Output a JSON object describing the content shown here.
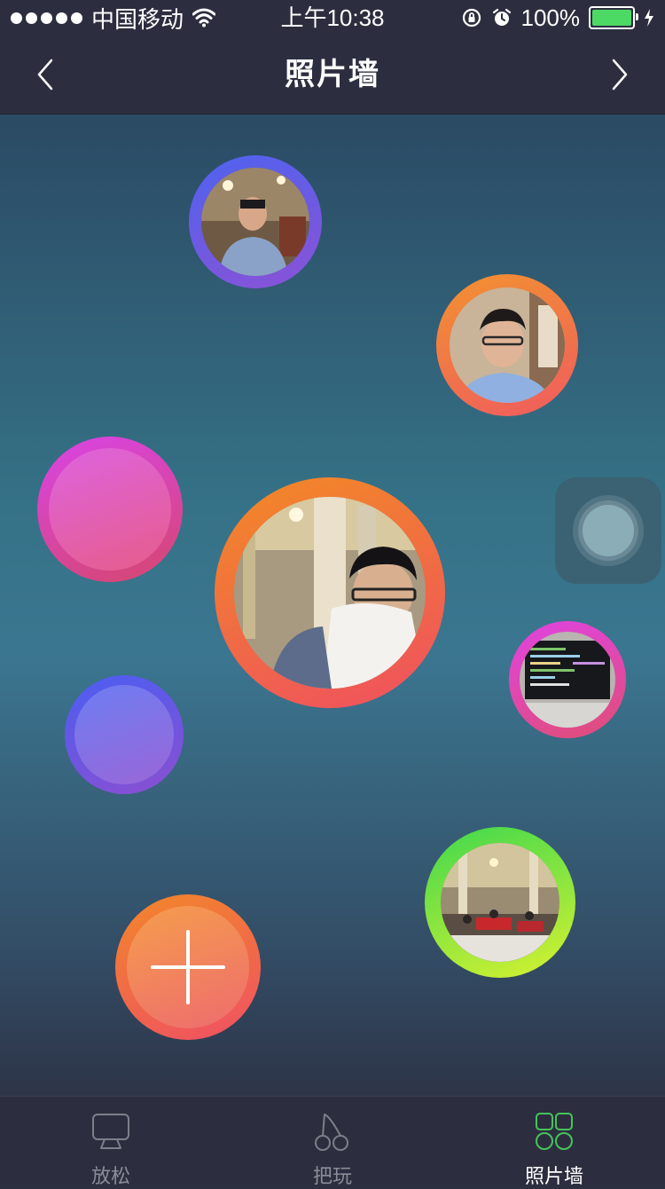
{
  "status_bar": {
    "carrier": "中国移动",
    "time": "上午10:38",
    "battery": "100%"
  },
  "nav": {
    "title": "照片墙",
    "back_icon": "chevron-left-icon",
    "forward_icon": "chevron-right-icon"
  },
  "bubbles": [
    {
      "kind": "photo",
      "subject": "portrait",
      "ring": [
        "#4e63ef",
        "#8b52d6"
      ]
    },
    {
      "kind": "photo",
      "subject": "portrait",
      "ring": [
        "#f29230",
        "#ef5c5f"
      ]
    },
    {
      "kind": "empty",
      "ring": [
        "#d844e6",
        "#d6476e"
      ],
      "fill": [
        "#de63e0",
        "#e65d8a"
      ]
    },
    {
      "kind": "photo",
      "subject": "selfie",
      "ring": [
        "#f28a25",
        "#ef5060"
      ]
    },
    {
      "kind": "photo",
      "subject": "screen",
      "ring": [
        "#e043e3",
        "#e04e74"
      ]
    },
    {
      "kind": "empty",
      "ring": [
        "#4b5ef2",
        "#8b4fd0"
      ],
      "fill": [
        "#6c7ef2",
        "#9a66d8"
      ]
    },
    {
      "kind": "photo",
      "subject": "hall",
      "ring": [
        "#3fd84e",
        "#d8f230"
      ]
    },
    {
      "kind": "add",
      "ring": [
        "#f2872a",
        "#ef5063"
      ],
      "fill": [
        "#f59d4c",
        "#ee6c6e"
      ],
      "icon": "plus-icon"
    }
  ],
  "assistive_touch": {
    "icon": "assistive-touch-icon"
  },
  "tabs": [
    {
      "label": "放松",
      "icon": "monitor-icon",
      "active": false
    },
    {
      "label": "把玩",
      "icon": "cherries-icon",
      "active": false
    },
    {
      "label": "照片墙",
      "icon": "grid-icon",
      "active": true
    }
  ],
  "colors": {
    "bar_bg": "#2c2e3f",
    "tab_active": "#46c35a",
    "tab_inactive": "#7c7f8a"
  }
}
